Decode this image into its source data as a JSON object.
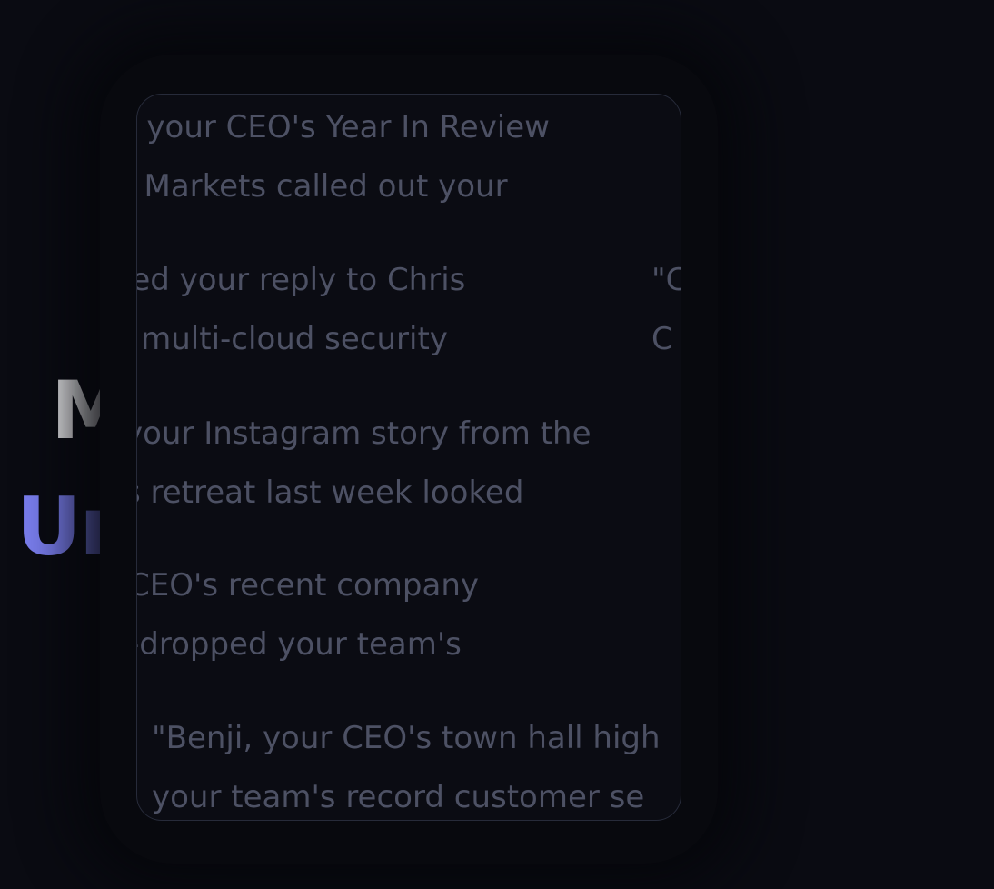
{
  "headline": {
    "line1": "Marketing,",
    "line2": "Unconventional."
  },
  "quotes": [
    {
      "line1": "d your CEO's Year In Review",
      "line2": "c Markets called out your"
    },
    {
      "line1": "ted your reply to Chris",
      "line2": "t multi-cloud security"
    },
    {
      "line1": "\"C",
      "line2": "C"
    },
    {
      "line1": "your Instagram story from the",
      "line2": "s retreat last week looked"
    },
    {
      "line1": "CEO's recent company",
      "line2": "-dropped your team's"
    },
    {
      "line1": "\"Benji, your CEO's town hall high",
      "line2": "your team's record customer se"
    }
  ]
}
